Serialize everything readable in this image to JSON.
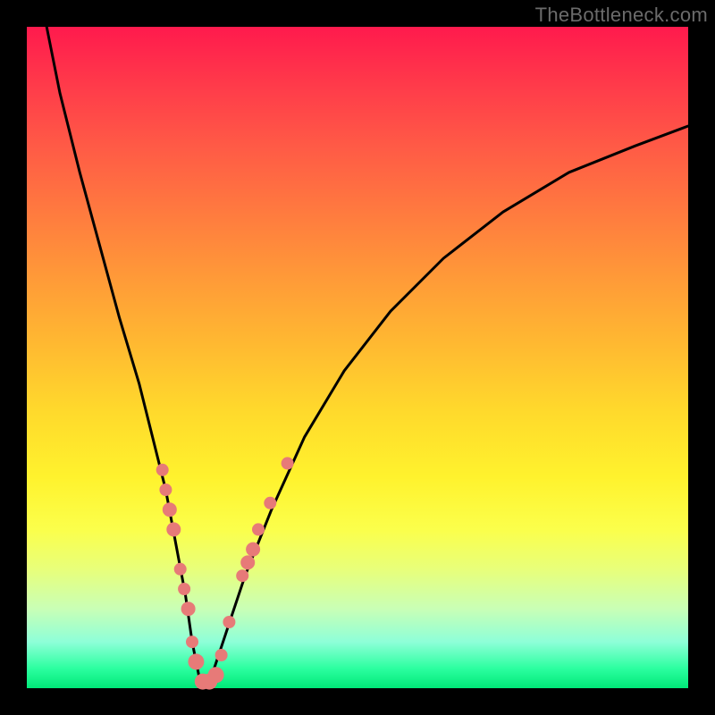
{
  "watermark": "TheBottleneck.com",
  "chart_data": {
    "type": "line",
    "title": "",
    "xlabel": "",
    "ylabel": "",
    "xlim": [
      0,
      100
    ],
    "ylim": [
      0,
      100
    ],
    "background_gradient": {
      "top_color": "#ff1a4d",
      "bottom_color": "#00e878",
      "meaning": "red=high bottleneck, green=low bottleneck"
    },
    "series": [
      {
        "name": "bottleneck-curve",
        "color": "#000000",
        "x": [
          3,
          5,
          8,
          11,
          14,
          17,
          19,
          21,
          22.5,
          24,
          25,
          26,
          27,
          28,
          30,
          33,
          37,
          42,
          48,
          55,
          63,
          72,
          82,
          92,
          100
        ],
        "y": [
          100,
          90,
          78,
          67,
          56,
          46,
          38,
          30,
          22,
          14,
          7,
          2,
          0,
          2,
          8,
          17,
          27,
          38,
          48,
          57,
          65,
          72,
          78,
          82,
          85
        ]
      }
    ],
    "markers": [
      {
        "name": "sample-points",
        "color": "#e77a78",
        "points": [
          {
            "x": 20.5,
            "y": 33,
            "r": 7
          },
          {
            "x": 21.0,
            "y": 30,
            "r": 7
          },
          {
            "x": 21.6,
            "y": 27,
            "r": 8
          },
          {
            "x": 22.2,
            "y": 24,
            "r": 8
          },
          {
            "x": 23.2,
            "y": 18,
            "r": 7
          },
          {
            "x": 23.8,
            "y": 15,
            "r": 7
          },
          {
            "x": 24.4,
            "y": 12,
            "r": 8
          },
          {
            "x": 25.0,
            "y": 7,
            "r": 7
          },
          {
            "x": 25.6,
            "y": 4,
            "r": 9
          },
          {
            "x": 26.6,
            "y": 1,
            "r": 9
          },
          {
            "x": 27.6,
            "y": 1,
            "r": 9
          },
          {
            "x": 28.6,
            "y": 2,
            "r": 9
          },
          {
            "x": 29.4,
            "y": 5,
            "r": 7
          },
          {
            "x": 30.6,
            "y": 10,
            "r": 7
          },
          {
            "x": 32.6,
            "y": 17,
            "r": 7
          },
          {
            "x": 33.4,
            "y": 19,
            "r": 8
          },
          {
            "x": 34.2,
            "y": 21,
            "r": 8
          },
          {
            "x": 35.0,
            "y": 24,
            "r": 7
          },
          {
            "x": 36.8,
            "y": 28,
            "r": 7
          },
          {
            "x": 39.4,
            "y": 34,
            "r": 7
          }
        ]
      }
    ]
  }
}
